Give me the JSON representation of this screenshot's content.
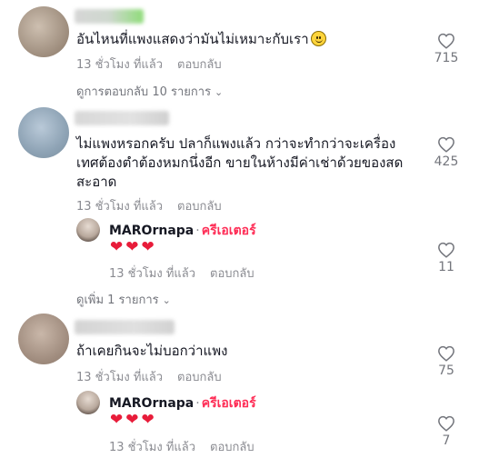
{
  "comments": [
    {
      "text": "อันไหนที่แพงแสดงว่ามันไม่เหมาะกับเรา",
      "emoji": "slightly-smiling-face",
      "time": "13 ชั่วโมง ที่แล้ว",
      "reply_label": "ตอบกลับ",
      "likes": "715",
      "view_replies": "ดูการตอบกลับ 10 รายการ"
    },
    {
      "text_lines": [
        "ไม่แพงหรอกครับ ปลาก็แพงแล้ว กว่าจะทำกว่าจะเครื่อง",
        "เทศต้องตำต้องหมกนึ่งอีก ขายในห้างมีค่าเช่าด้วยของสด",
        "สะอาด"
      ],
      "time": "13 ชั่วโมง ที่แล้ว",
      "reply_label": "ตอบกลับ",
      "likes": "425",
      "reply": {
        "author": "MAROrnapa",
        "separator": "·",
        "badge": "ครีเอเตอร์",
        "hearts": "❤❤❤",
        "time": "13 ชั่วโมง ที่แล้ว",
        "reply_label": "ตอบกลับ",
        "likes": "11"
      },
      "view_more": "ดูเพิ่ม 1 รายการ"
    },
    {
      "text": "ถ้าเคยกินจะไม่บอกว่าแพง",
      "time": "13 ชั่วโมง ที่แล้ว",
      "reply_label": "ตอบกลับ",
      "likes": "75",
      "reply": {
        "author": "MAROrnapa",
        "separator": "·",
        "badge": "ครีเอเตอร์",
        "hearts": "❤❤❤",
        "time": "13 ชั่วโมง ที่แล้ว",
        "reply_label": "ตอบกลับ",
        "likes": "7"
      }
    }
  ],
  "chevron_glyph": "⌄",
  "colors": {
    "creator_badge": "#fe2c55",
    "heart_emoji": "#e81c3a",
    "meta_text": "#8a8b91"
  }
}
